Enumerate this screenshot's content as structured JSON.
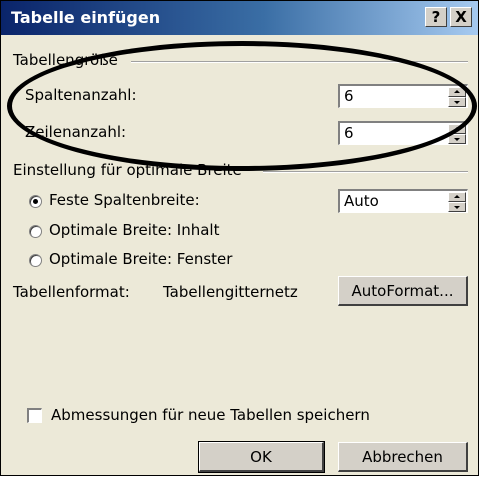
{
  "window": {
    "title": "Tabelle einfügen",
    "help_button": "?",
    "close_button": "X"
  },
  "table_size": {
    "group_label": "Tabellengröße",
    "columns_label": "Spaltenanzahl:",
    "columns_value": "6",
    "rows_label": "Zeilenanzahl:",
    "rows_value": "6"
  },
  "autofit": {
    "group_label": "Einstellung für optimale Breite",
    "options": [
      {
        "label": "Feste Spaltenbreite:",
        "selected": true
      },
      {
        "label": "Optimale Breite: Inhalt",
        "selected": false
      },
      {
        "label": "Optimale Breite: Fenster",
        "selected": false
      }
    ],
    "fixed_width_value": "Auto"
  },
  "format": {
    "label": "Tabellenformat:",
    "value": "Tabellengitternetz",
    "autoformat_button": "AutoFormat..."
  },
  "remember_checkbox": {
    "label": "Abmessungen für neue Tabellen speichern",
    "checked": false
  },
  "buttons": {
    "ok": "OK",
    "cancel": "Abbrechen"
  },
  "colors": {
    "dialog_bg": "#ece9d8",
    "titlebar_start": "#0a246a",
    "titlebar_end": "#a6caf0"
  }
}
